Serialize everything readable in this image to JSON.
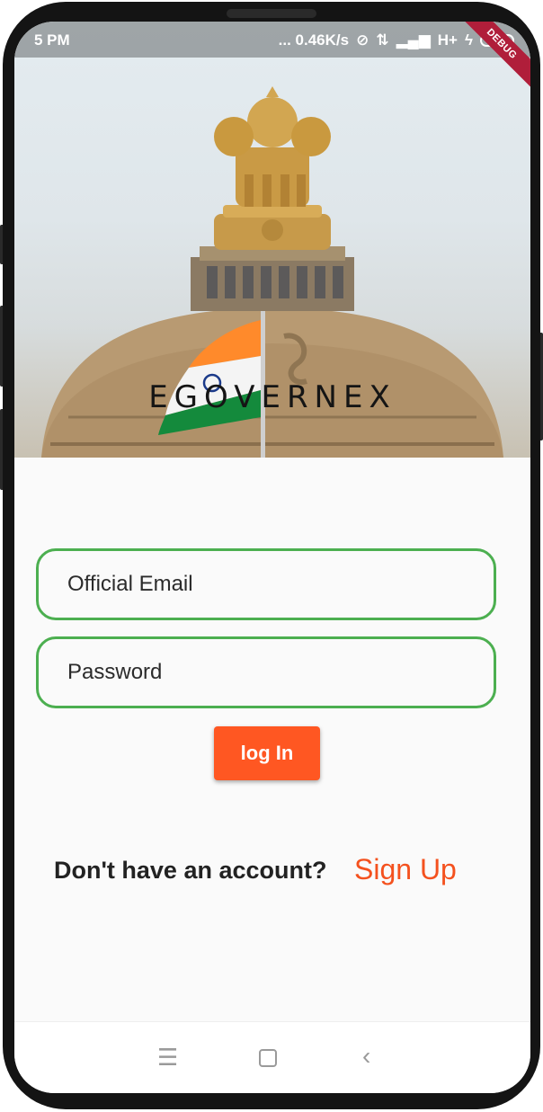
{
  "status_bar": {
    "time": "5 PM",
    "network_speed": "... 0.46K/s",
    "network_type": "H+",
    "battery_fill_percent": 20
  },
  "debug_banner": "DEBUG",
  "app": {
    "title": "EGOVERNEX"
  },
  "login_form": {
    "email_placeholder": "Official Email",
    "email_value": "",
    "password_placeholder": "Password",
    "password_value": "",
    "login_label": "log In"
  },
  "signup": {
    "prompt": "Don't have an account?",
    "link_label": "Sign Up"
  },
  "nav_bar": {
    "icons": [
      "menu-icon",
      "home-square-icon",
      "back-chevron-icon"
    ]
  },
  "colors": {
    "accent": "#ff5722",
    "field_border": "#4caf50",
    "signup_link": "#f4511e"
  }
}
